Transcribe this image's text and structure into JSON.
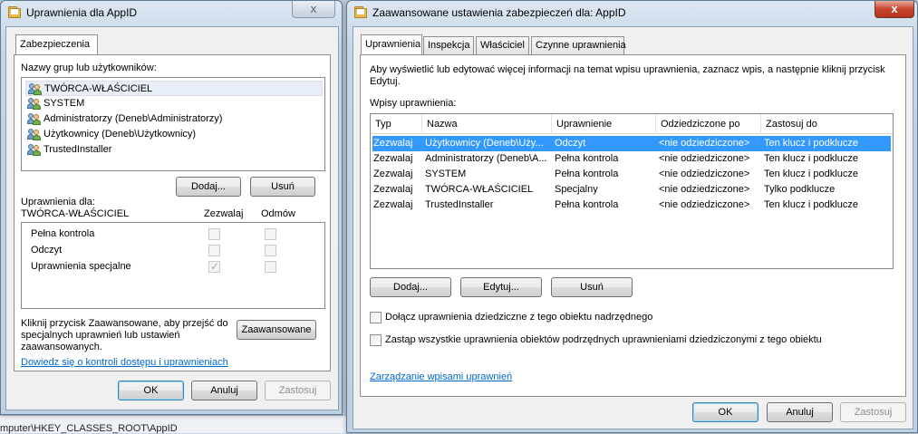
{
  "background": {
    "path_text": "mputer\\HKEY_CLASSES_ROOT\\AppID"
  },
  "left_dialog": {
    "title": "Uprawnienia dla AppID",
    "close_glyph": "x",
    "tab": "Zabezpieczenia",
    "groups_label": "Nazwy grup lub użytkowników:",
    "users": [
      "TWÓRCA-WŁAŚCICIEL",
      "SYSTEM",
      "Administratorzy (Deneb\\Administratorzy)",
      "Użytkownicy (Deneb\\Użytkownicy)",
      "TrustedInstaller"
    ],
    "add_button": "Dodaj...",
    "remove_button": "Usuń",
    "permissions_for_label": "Uprawnienia dla:",
    "permissions_for_user": "TWÓRCA-WŁAŚCICIEL",
    "allow_header": "Zezwalaj",
    "deny_header": "Odmów",
    "permissions": [
      {
        "name": "Pełna kontrola",
        "allow": false,
        "deny": false
      },
      {
        "name": "Odczyt",
        "allow": false,
        "deny": false
      },
      {
        "name": "Uprawnienia specjalne",
        "allow": true,
        "deny": false
      }
    ],
    "advanced_note": "Kliknij przycisk Zaawansowane, aby przejść do specjalnych uprawnień lub ustawień zaawansowanych.",
    "advanced_note_lines": [
      "Kliknij przycisk Zaawansowane, aby przejść do",
      "specjalnych uprawnień lub ustawień",
      "zaawansowanych."
    ],
    "advanced_button": "Zaawansowane",
    "link": "Dowiedz się o kontroli dostępu i uprawnieniach",
    "ok": "OK",
    "cancel": "Anuluj",
    "apply": "Zastosuj"
  },
  "right_dialog": {
    "title": "Zaawansowane ustawienia zabezpieczeń dla: AppID",
    "close_glyph": "x",
    "tabs": [
      "Uprawnienia",
      "Inspekcja",
      "Właściciel",
      "Czynne uprawnienia"
    ],
    "info_lines": [
      "Aby wyświetlić lub edytować więcej informacji na temat wpisu uprawnienia, zaznacz wpis, a następnie kliknij przycisk",
      "Edytuj."
    ],
    "entries_label": "Wpisy uprawnienia:",
    "columns": [
      "Typ",
      "Nazwa",
      "Uprawnienie",
      "Odziedziczone po",
      "Zastosuj do"
    ],
    "rows": [
      [
        "Zezwalaj",
        "Użytkownicy (Deneb\\Uży...",
        "Odczyt",
        "<nie odziedziczone>",
        "Ten klucz i podklucze"
      ],
      [
        "Zezwalaj",
        "Administratorzy (Deneb\\A...",
        "Pełna kontrola",
        "<nie odziedziczone>",
        "Ten klucz i podklucze"
      ],
      [
        "Zezwalaj",
        "SYSTEM",
        "Pełna kontrola",
        "<nie odziedziczone>",
        "Ten klucz i podklucze"
      ],
      [
        "Zezwalaj",
        "TWÓRCA-WŁAŚCICIEL",
        "Specjalny",
        "<nie odziedziczone>",
        "Tylko podklucze"
      ],
      [
        "Zezwalaj",
        "TrustedInstaller",
        "Pełna kontrola",
        "<nie odziedziczone>",
        "Ten klucz i podklucze"
      ]
    ],
    "add_button": "Dodaj...",
    "edit_button": "Edytuj...",
    "remove_button": "Usuń",
    "include_inheritable": "Dołącz uprawnienia dziedziczne z tego obiektu nadrzędnego",
    "replace_child": "Zastąp wszystkie uprawnienia obiektów podrzędnych uprawnieniami dziedziczonymi z tego obiektu",
    "manage_link": "Zarządzanie wpisami uprawnień",
    "ok": "OK",
    "cancel": "Anuluj",
    "apply": "Zastosuj"
  },
  "colors": {
    "selection": "#3399ff",
    "link": "#0066cc",
    "close_active": "#c7452f"
  }
}
